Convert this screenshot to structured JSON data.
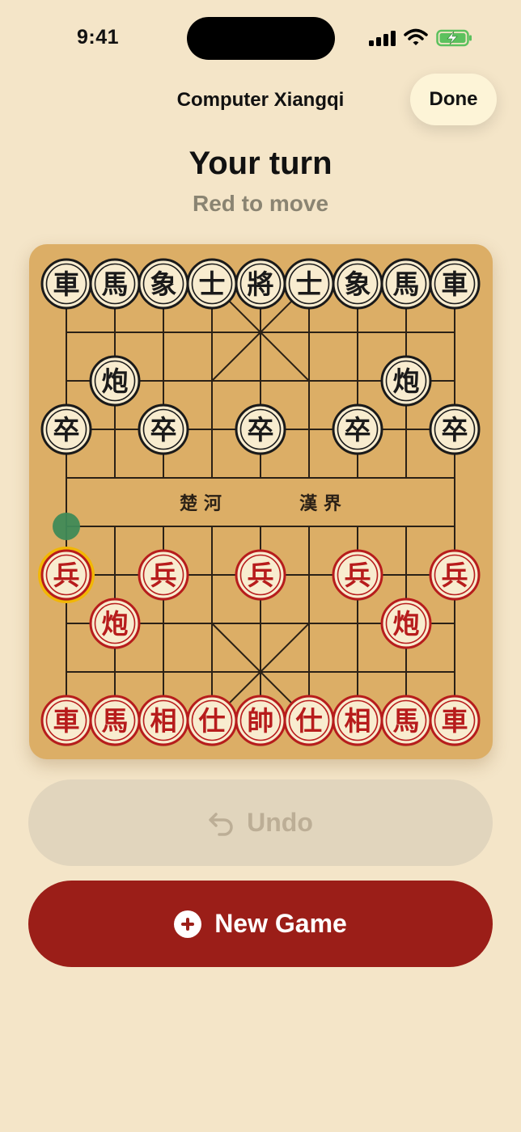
{
  "status": {
    "time": "9:41"
  },
  "nav": {
    "title": "Computer Xiangqi",
    "done_label": "Done"
  },
  "turn": {
    "title": "Your turn",
    "subtitle": "Red to move"
  },
  "board": {
    "river_left": "楚 河",
    "river_right": "漢 界",
    "selected": {
      "file": 0,
      "rank": 6
    },
    "move_hint": {
      "file": 0,
      "rank": 5
    },
    "pieces": [
      {
        "side": "black",
        "char": "車",
        "file": 0,
        "rank": 0
      },
      {
        "side": "black",
        "char": "馬",
        "file": 1,
        "rank": 0
      },
      {
        "side": "black",
        "char": "象",
        "file": 2,
        "rank": 0
      },
      {
        "side": "black",
        "char": "士",
        "file": 3,
        "rank": 0
      },
      {
        "side": "black",
        "char": "將",
        "file": 4,
        "rank": 0
      },
      {
        "side": "black",
        "char": "士",
        "file": 5,
        "rank": 0
      },
      {
        "side": "black",
        "char": "象",
        "file": 6,
        "rank": 0
      },
      {
        "side": "black",
        "char": "馬",
        "file": 7,
        "rank": 0
      },
      {
        "side": "black",
        "char": "車",
        "file": 8,
        "rank": 0
      },
      {
        "side": "black",
        "char": "炮",
        "file": 1,
        "rank": 2
      },
      {
        "side": "black",
        "char": "炮",
        "file": 7,
        "rank": 2
      },
      {
        "side": "black",
        "char": "卒",
        "file": 0,
        "rank": 3
      },
      {
        "side": "black",
        "char": "卒",
        "file": 2,
        "rank": 3
      },
      {
        "side": "black",
        "char": "卒",
        "file": 4,
        "rank": 3
      },
      {
        "side": "black",
        "char": "卒",
        "file": 6,
        "rank": 3
      },
      {
        "side": "black",
        "char": "卒",
        "file": 8,
        "rank": 3
      },
      {
        "side": "red",
        "char": "兵",
        "file": 0,
        "rank": 6
      },
      {
        "side": "red",
        "char": "兵",
        "file": 2,
        "rank": 6
      },
      {
        "side": "red",
        "char": "兵",
        "file": 4,
        "rank": 6
      },
      {
        "side": "red",
        "char": "兵",
        "file": 6,
        "rank": 6
      },
      {
        "side": "red",
        "char": "兵",
        "file": 8,
        "rank": 6
      },
      {
        "side": "red",
        "char": "炮",
        "file": 1,
        "rank": 7
      },
      {
        "side": "red",
        "char": "炮",
        "file": 7,
        "rank": 7
      },
      {
        "side": "red",
        "char": "車",
        "file": 0,
        "rank": 9
      },
      {
        "side": "red",
        "char": "馬",
        "file": 1,
        "rank": 9
      },
      {
        "side": "red",
        "char": "相",
        "file": 2,
        "rank": 9
      },
      {
        "side": "red",
        "char": "仕",
        "file": 3,
        "rank": 9
      },
      {
        "side": "red",
        "char": "帥",
        "file": 4,
        "rank": 9
      },
      {
        "side": "red",
        "char": "仕",
        "file": 5,
        "rank": 9
      },
      {
        "side": "red",
        "char": "相",
        "file": 6,
        "rank": 9
      },
      {
        "side": "red",
        "char": "馬",
        "file": 7,
        "rank": 9
      },
      {
        "side": "red",
        "char": "車",
        "file": 8,
        "rank": 9
      }
    ],
    "colors": {
      "board": "#dcae66",
      "line": "#2b2116",
      "red_piece": "#b71c1c",
      "black_piece": "#1a1a1a",
      "piece_face": "#f8eccf",
      "selection": "#f2b705",
      "hint": "#3f8a57"
    }
  },
  "buttons": {
    "undo_label": "Undo",
    "new_game_label": "New Game"
  },
  "icons": {
    "undo": "undo-arrow-icon",
    "new_game": "plus-circle-icon",
    "signal": "cellular-signal-icon",
    "wifi": "wifi-icon",
    "battery": "battery-charging-icon"
  }
}
